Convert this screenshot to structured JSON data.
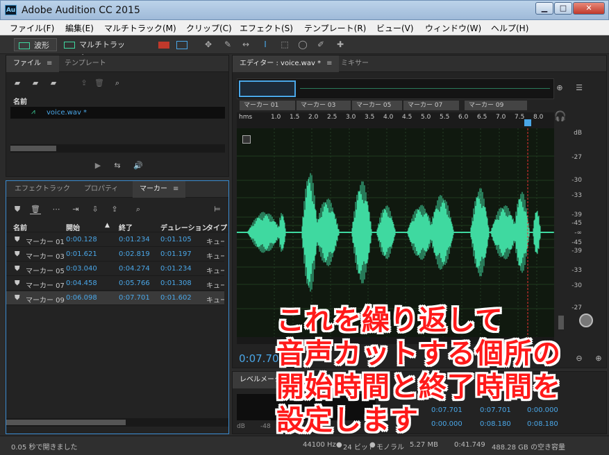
{
  "window": {
    "title": "Adobe Audition CC 2015",
    "app_icon": "Au",
    "min": "▁",
    "max": "□",
    "close": "✕"
  },
  "menu": [
    "ファイル(F)",
    "編集(E)",
    "マルチトラック(M)",
    "クリップ(C)",
    "エフェクト(S)",
    "テンプレート(R)",
    "ビュー(V)",
    "ウィンドウ(W)",
    "ヘルプ(H)"
  ],
  "toolbar": {
    "waveform": "波形",
    "multitrack": "マルチトラック"
  },
  "files_panel": {
    "tab_files": "ファイル",
    "tab_template": "テンプレート",
    "col_name": "名前",
    "file": "voice.wav *"
  },
  "markers_panel": {
    "tab_effects": "エフェクトラック",
    "tab_props": "プロパティ",
    "tab_markers": "マーカー",
    "cols": [
      "名前",
      "開始",
      "終了",
      "デュレーション",
      "タイプ"
    ],
    "rows": [
      {
        "name": "マーカー 01",
        "start": "0:00.128",
        "end": "0:01.234",
        "dur": "0:01.105",
        "type": "キュー"
      },
      {
        "name": "マーカー 03",
        "start": "0:01.621",
        "end": "0:02.819",
        "dur": "0:01.197",
        "type": "キュー"
      },
      {
        "name": "マーカー 05",
        "start": "0:03.040",
        "end": "0:04.274",
        "dur": "0:01.234",
        "type": "キュー"
      },
      {
        "name": "マーカー 07",
        "start": "0:04.458",
        "end": "0:05.766",
        "dur": "0:01.308",
        "type": "キュー"
      },
      {
        "name": "マーカー 09",
        "start": "0:06.098",
        "end": "0:07.701",
        "dur": "0:01.602",
        "type": "キュー"
      }
    ]
  },
  "editor": {
    "tab_editor": "エディター : voice.wav *",
    "tab_mixer": "ミキサー",
    "marker_labels": [
      "マーカー 01",
      "マーカー 03",
      "マーカー 05",
      "マーカー 07",
      "マーカー 09"
    ],
    "ruler_unit": "hms",
    "ruler_ticks": [
      "1.0",
      "1.5",
      "2.0",
      "2.5",
      "3.0",
      "3.5",
      "4.0",
      "4.5",
      "5.0",
      "5.5",
      "6.0",
      "6.5",
      "7.0",
      "7.5",
      "8.0"
    ],
    "db_label": "dB",
    "db_ticks": [
      "-27",
      "-30",
      "-33",
      "-39",
      "-45",
      "-∞",
      "-45",
      "-39",
      "-33",
      "-30",
      "-27"
    ],
    "time": "0:07.701",
    "waveform_color": "#3fd9a0"
  },
  "level": {
    "title": "レベルメーター",
    "scale": [
      "dB",
      "-48"
    ],
    "sel_start": "0:07.701",
    "sel_end": "0:07.701",
    "sel_dur": "0:00.000",
    "view_start": "0:00.000",
    "view_end": "0:08.180",
    "view_dur": "0:08.180"
  },
  "overlay": [
    "これを繰り返して",
    "音声カットする個所の",
    "開始時間と終了時間を",
    "設定します"
  ],
  "status": {
    "left": "0.05 秒で開きました",
    "rate": "44100 Hz",
    "bits": "24 ビット",
    "ch": "モノラル",
    "size": "5.27 MB",
    "dur": "0:41.749",
    "free": "488.28 GB の空き容量"
  }
}
